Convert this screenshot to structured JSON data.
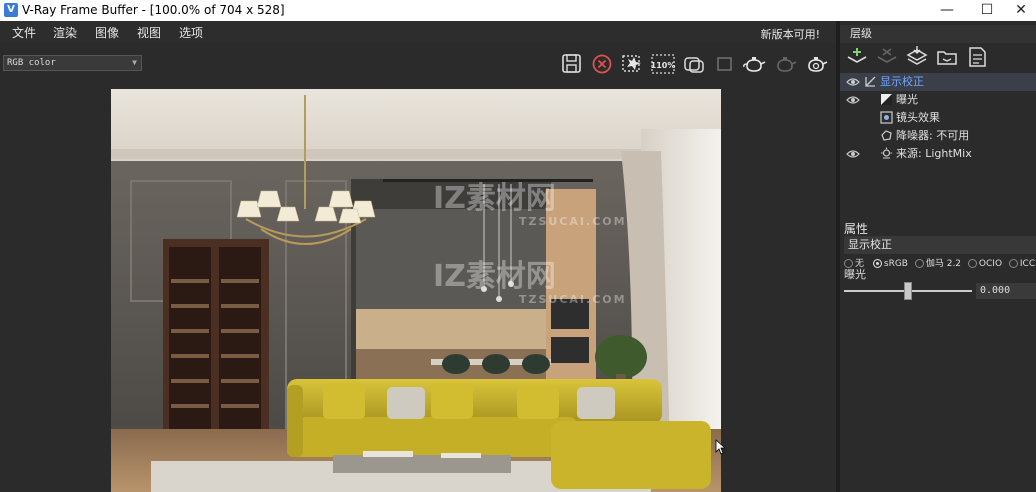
{
  "window": {
    "icon_letter": "V",
    "title": "V-Ray Frame Buffer - [100.0% of 704 x 528]",
    "minimize": "—",
    "maximize": "☐",
    "close": "✕"
  },
  "menu": {
    "items": [
      "文件",
      "渲染",
      "图像",
      "视图",
      "选项"
    ],
    "update_notice": "新版本可用!"
  },
  "toolbar": {
    "channel_select": "RGB color",
    "zoom_label": "110%"
  },
  "panel": {
    "layers_title": "层级",
    "layers": [
      {
        "label": "显示校正",
        "visible": true,
        "selected": true
      },
      {
        "label": "曝光",
        "visible": true,
        "selected": false
      },
      {
        "label": "镜头效果",
        "visible": false,
        "selected": false
      },
      {
        "label": "降噪器: 不可用",
        "visible": false,
        "selected": false
      },
      {
        "label": "来源: LightMix",
        "visible": true,
        "selected": false
      }
    ],
    "properties_title": "属性",
    "prop_selected": "显示校正",
    "radio_options": [
      "无",
      "sRGB",
      "伽马 2.2",
      "OCIO",
      "ICC"
    ],
    "radio_selected": "sRGB",
    "exposure_label": "曝光",
    "exposure_value": "0.000",
    "exposure_fraction": 0.5
  },
  "watermark": {
    "line1": "IZ素材网",
    "line1_sub": "TZSUCAI.COM",
    "line2": "IZ素材网",
    "line2_sub": "TZSUCAI.COM"
  },
  "colors": {
    "accent": "#3a7bd5",
    "sofa": "#c8b429",
    "panel_bg": "#2b2b2b"
  }
}
